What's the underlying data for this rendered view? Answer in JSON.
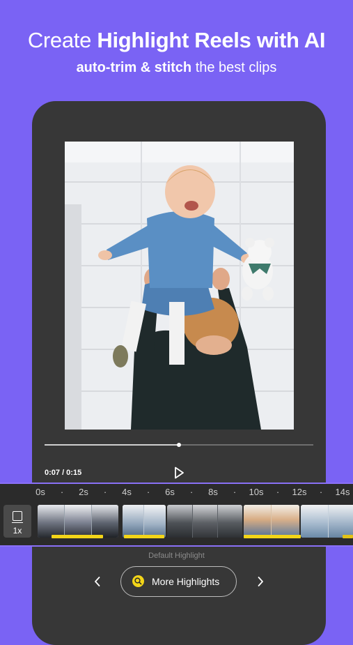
{
  "header": {
    "title_prefix": "Create",
    "title_bold": "Highlight Reels with AI",
    "subtitle_bold": "auto-trim & stitch",
    "subtitle_rest": "the best clips"
  },
  "player": {
    "time": "0:07 / 0:15",
    "progress": 0.5
  },
  "timeline": {
    "ticks": [
      "0s",
      "·",
      "2s",
      "·",
      "4s",
      "·",
      "6s",
      "·",
      "8s",
      "·",
      "10s",
      "·",
      "12s",
      "·",
      "14s"
    ],
    "speed": "1x"
  },
  "highlight_label": "Default Highlight",
  "more_button": "More Highlights",
  "colors": {
    "background": "#7a63f4",
    "phone": "#373737",
    "accent_yellow": "#f3d518",
    "timeline_border": "#8a70f6"
  }
}
